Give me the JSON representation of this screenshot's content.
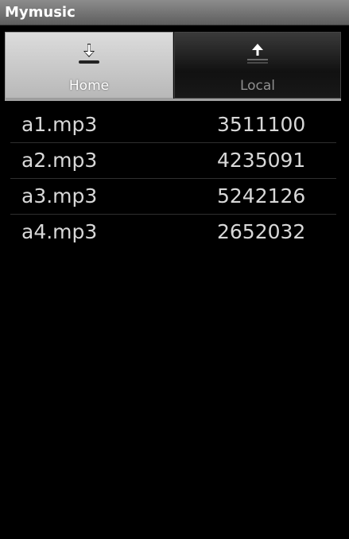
{
  "app": {
    "title": "Mymusic"
  },
  "tabs": [
    {
      "label": "Home",
      "icon": "download-icon",
      "selected": true
    },
    {
      "label": "Local",
      "icon": "upload-icon",
      "selected": false
    }
  ],
  "files": [
    {
      "name": "a1.mp3",
      "size": "3511100"
    },
    {
      "name": "a2.mp3",
      "size": "4235091"
    },
    {
      "name": "a3.mp3",
      "size": "5242126"
    },
    {
      "name": "a4.mp3",
      "size": "2652032"
    }
  ],
  "colors": {
    "background": "#000000",
    "titlebar": "#6e6e6e",
    "selected_tab": "#c8c8c8",
    "unselected_tab": "#1a1a1a",
    "text": "#d8d8d8"
  }
}
